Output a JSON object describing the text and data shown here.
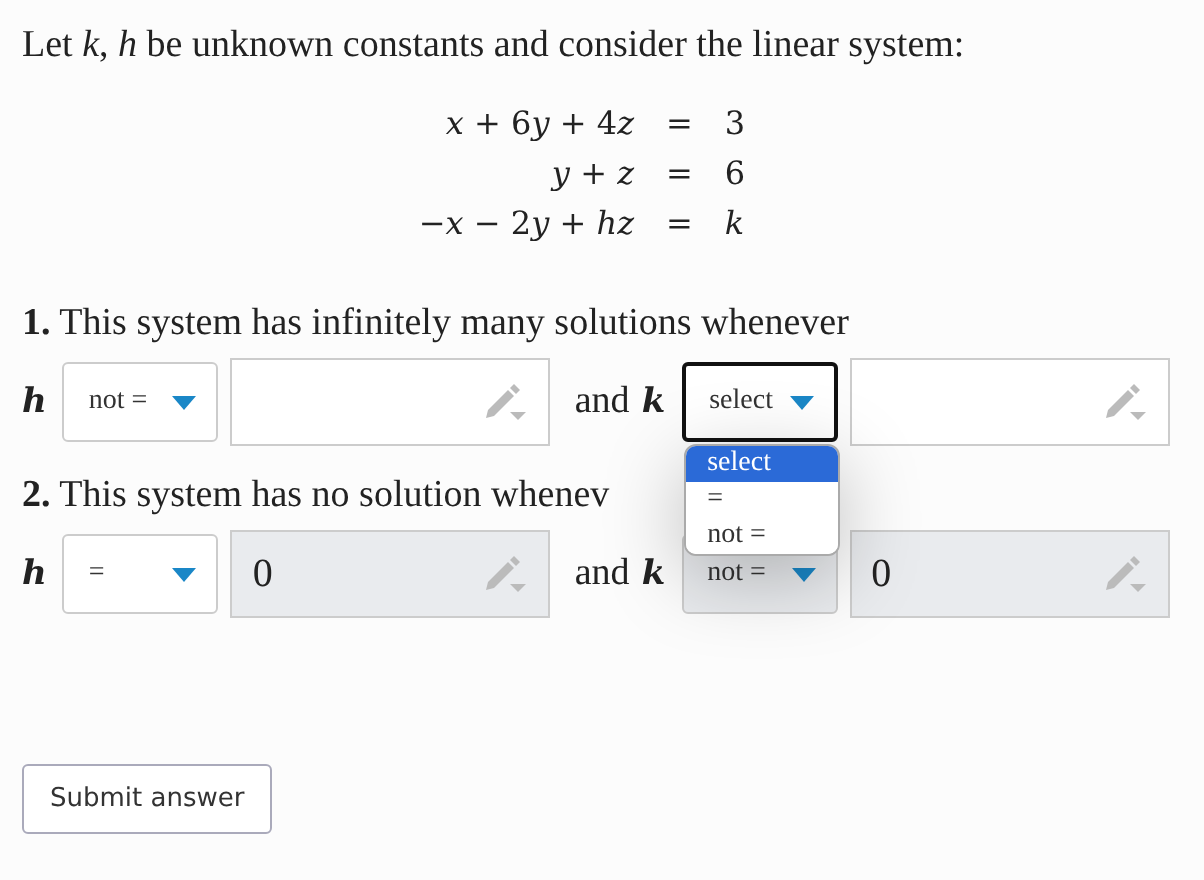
{
  "intro": "Let *k*, *h* be unknown constants and consider the linear system:",
  "equations": [
    {
      "lhs": "x + 6y + 4z",
      "sign": "=",
      "rhs": "3"
    },
    {
      "lhs": "y + z",
      "sign": "=",
      "rhs": "6"
    },
    {
      "lhs": "−x − 2y + hz",
      "sign": "=",
      "rhs": "k"
    }
  ],
  "questions": [
    {
      "number": "1.",
      "text": "This system has infinitely many solutions whenever",
      "parts": [
        {
          "variable": "h",
          "select": {
            "value": "not =",
            "focused": false
          },
          "field": {
            "disabled": false
          }
        },
        {
          "connector": "and",
          "variable": "k",
          "select": {
            "value": "select",
            "focused": true,
            "open": true,
            "options": [
              {
                "label": "select",
                "selected": true
              },
              {
                "label": "=",
                "selected": false
              },
              {
                "label": "not =",
                "selected": false
              }
            ]
          },
          "field": {
            "disabled": false
          }
        }
      ]
    },
    {
      "number": "2.",
      "text": "This system has no solution whenev",
      "parts": [
        {
          "variable": "h",
          "select": {
            "value": "=",
            "focused": false
          },
          "field": {
            "value": "0",
            "disabled": true
          }
        },
        {
          "connector": "and",
          "variable": "k",
          "select": {
            "value": "not =",
            "focused": false,
            "disabled": true
          },
          "field": {
            "value": "0",
            "disabled": true
          }
        }
      ]
    }
  ],
  "submit": "Submit answer"
}
